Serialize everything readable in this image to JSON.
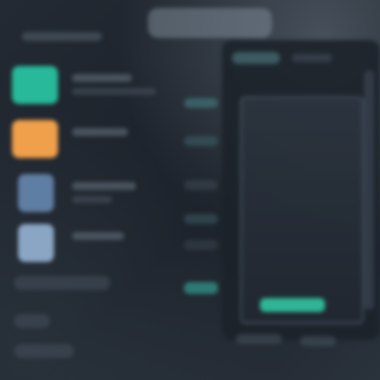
{
  "app": {
    "accent_teal": "#2fb596",
    "accent_orange": "#f0a04a",
    "tile_blue": "#6d8fb3",
    "background": "#1d232b"
  },
  "sidebar": {
    "items": [
      {
        "icon": "teal-app-tile-icon",
        "color": "#27b99a"
      },
      {
        "icon": "orange-app-tile-icon",
        "color": "#f0a04a"
      },
      {
        "icon": "blue-app-tile-icon",
        "color": "#5f7ea3"
      },
      {
        "icon": "light-blue-app-tile-icon",
        "color": "#8aa6c4"
      }
    ]
  },
  "main": {
    "chart": {
      "bar_fraction": 0.65
    }
  }
}
